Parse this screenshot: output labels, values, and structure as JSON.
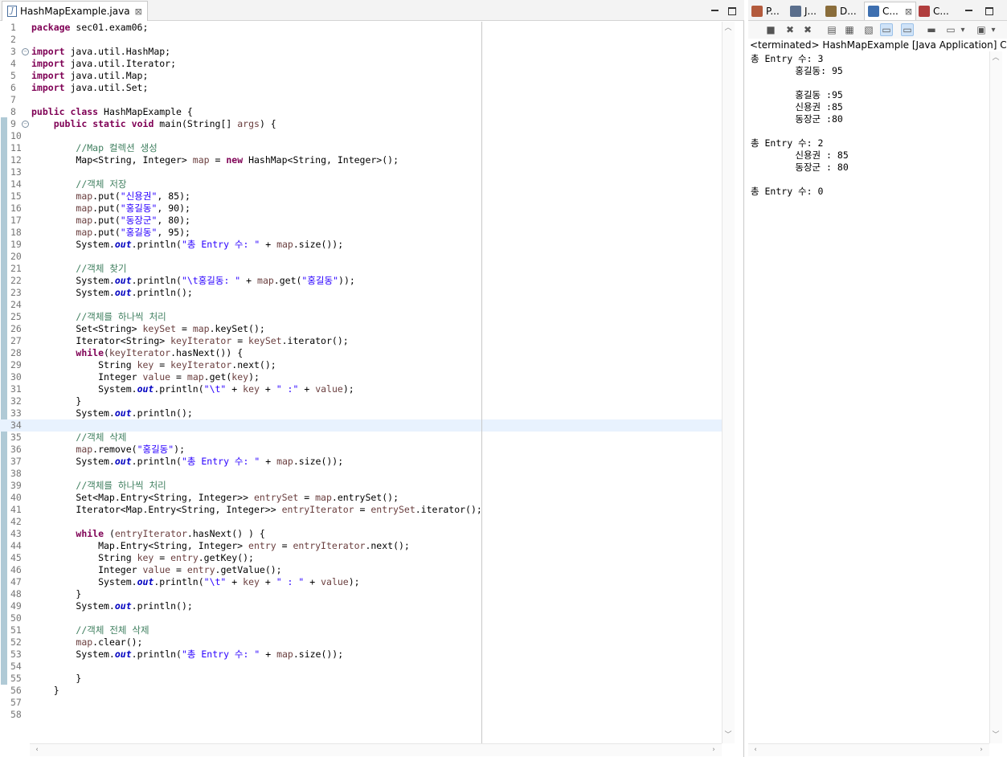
{
  "editor": {
    "tab": {
      "label": "HashMapExample.java",
      "close": "⊠",
      "icon": "java-file-icon"
    },
    "minimize_icon": "minimize-icon",
    "maximize_icon": "maximize-icon",
    "lines": [
      {
        "n": "1",
        "t": [
          {
            "k": "k",
            "x": "package"
          },
          {
            "k": "",
            "x": " sec01.exam06;"
          }
        ]
      },
      {
        "n": "2",
        "t": []
      },
      {
        "n": "3",
        "fold": true,
        "t": [
          {
            "k": "k",
            "x": "import"
          },
          {
            "k": "",
            "x": " java.util.HashMap;"
          }
        ]
      },
      {
        "n": "4",
        "t": [
          {
            "k": "k",
            "x": "import"
          },
          {
            "k": "",
            "x": " java.util.Iterator;"
          }
        ]
      },
      {
        "n": "5",
        "t": [
          {
            "k": "k",
            "x": "import"
          },
          {
            "k": "",
            "x": " java.util.Map;"
          }
        ]
      },
      {
        "n": "6",
        "t": [
          {
            "k": "k",
            "x": "import"
          },
          {
            "k": "",
            "x": " java.util.Set;"
          }
        ]
      },
      {
        "n": "7",
        "t": []
      },
      {
        "n": "8",
        "t": [
          {
            "k": "k",
            "x": "public"
          },
          {
            "k": "",
            "x": " "
          },
          {
            "k": "k",
            "x": "class"
          },
          {
            "k": "",
            "x": " HashMapExample {"
          }
        ]
      },
      {
        "n": "9",
        "fold": true,
        "t": [
          {
            "k": "",
            "x": "    "
          },
          {
            "k": "k",
            "x": "public"
          },
          {
            "k": "",
            "x": " "
          },
          {
            "k": "k",
            "x": "static"
          },
          {
            "k": "",
            "x": " "
          },
          {
            "k": "k",
            "x": "void"
          },
          {
            "k": "",
            "x": " main(String[] "
          },
          {
            "k": "v",
            "x": "args"
          },
          {
            "k": "",
            "x": ") {"
          }
        ]
      },
      {
        "n": "10",
        "t": []
      },
      {
        "n": "11",
        "t": [
          {
            "k": "",
            "x": "        "
          },
          {
            "k": "c",
            "x": "//Map 컬렉션 생성"
          }
        ]
      },
      {
        "n": "12",
        "t": [
          {
            "k": "",
            "x": "        Map<String, Integer> "
          },
          {
            "k": "v",
            "x": "map"
          },
          {
            "k": "",
            "x": " = "
          },
          {
            "k": "k",
            "x": "new"
          },
          {
            "k": "",
            "x": " HashMap<String, Integer>();"
          }
        ]
      },
      {
        "n": "13",
        "t": []
      },
      {
        "n": "14",
        "t": [
          {
            "k": "",
            "x": "        "
          },
          {
            "k": "c",
            "x": "//객체 저장"
          }
        ]
      },
      {
        "n": "15",
        "t": [
          {
            "k": "",
            "x": "        "
          },
          {
            "k": "v",
            "x": "map"
          },
          {
            "k": "",
            "x": ".put("
          },
          {
            "k": "s",
            "x": "\"신용권\""
          },
          {
            "k": "",
            "x": ", 85);"
          }
        ]
      },
      {
        "n": "16",
        "t": [
          {
            "k": "",
            "x": "        "
          },
          {
            "k": "v",
            "x": "map"
          },
          {
            "k": "",
            "x": ".put("
          },
          {
            "k": "s",
            "x": "\"홍길동\""
          },
          {
            "k": "",
            "x": ", 90);"
          }
        ]
      },
      {
        "n": "17",
        "t": [
          {
            "k": "",
            "x": "        "
          },
          {
            "k": "v",
            "x": "map"
          },
          {
            "k": "",
            "x": ".put("
          },
          {
            "k": "s",
            "x": "\"동장군\""
          },
          {
            "k": "",
            "x": ", 80);"
          }
        ]
      },
      {
        "n": "18",
        "t": [
          {
            "k": "",
            "x": "        "
          },
          {
            "k": "v",
            "x": "map"
          },
          {
            "k": "",
            "x": ".put("
          },
          {
            "k": "s",
            "x": "\"홍길동\""
          },
          {
            "k": "",
            "x": ", 95);"
          }
        ]
      },
      {
        "n": "19",
        "t": [
          {
            "k": "",
            "x": "        System."
          },
          {
            "k": "f",
            "x": "out"
          },
          {
            "k": "",
            "x": ".println("
          },
          {
            "k": "s",
            "x": "\"총 Entry 수: \""
          },
          {
            "k": "",
            "x": " + "
          },
          {
            "k": "v",
            "x": "map"
          },
          {
            "k": "",
            "x": ".size());"
          }
        ]
      },
      {
        "n": "20",
        "t": []
      },
      {
        "n": "21",
        "t": [
          {
            "k": "",
            "x": "        "
          },
          {
            "k": "c",
            "x": "//객체 찾기"
          }
        ]
      },
      {
        "n": "22",
        "t": [
          {
            "k": "",
            "x": "        System."
          },
          {
            "k": "f",
            "x": "out"
          },
          {
            "k": "",
            "x": ".println("
          },
          {
            "k": "s",
            "x": "\"\\t홍길동: \""
          },
          {
            "k": "",
            "x": " + "
          },
          {
            "k": "v",
            "x": "map"
          },
          {
            "k": "",
            "x": ".get("
          },
          {
            "k": "s",
            "x": "\"홍길동\""
          },
          {
            "k": "",
            "x": "));"
          }
        ]
      },
      {
        "n": "23",
        "t": [
          {
            "k": "",
            "x": "        System."
          },
          {
            "k": "f",
            "x": "out"
          },
          {
            "k": "",
            "x": ".println();"
          }
        ]
      },
      {
        "n": "24",
        "t": []
      },
      {
        "n": "25",
        "t": [
          {
            "k": "",
            "x": "        "
          },
          {
            "k": "c",
            "x": "//객체를 하나씩 처리"
          }
        ]
      },
      {
        "n": "26",
        "t": [
          {
            "k": "",
            "x": "        Set<String> "
          },
          {
            "k": "v",
            "x": "keySet"
          },
          {
            "k": "",
            "x": " = "
          },
          {
            "k": "v",
            "x": "map"
          },
          {
            "k": "",
            "x": ".keySet();"
          }
        ]
      },
      {
        "n": "27",
        "t": [
          {
            "k": "",
            "x": "        Iterator<String> "
          },
          {
            "k": "v",
            "x": "keyIterator"
          },
          {
            "k": "",
            "x": " = "
          },
          {
            "k": "v",
            "x": "keySet"
          },
          {
            "k": "",
            "x": ".iterator();"
          }
        ]
      },
      {
        "n": "28",
        "t": [
          {
            "k": "",
            "x": "        "
          },
          {
            "k": "k",
            "x": "while"
          },
          {
            "k": "",
            "x": "("
          },
          {
            "k": "v",
            "x": "keyIterator"
          },
          {
            "k": "",
            "x": ".hasNext()) {"
          }
        ]
      },
      {
        "n": "29",
        "t": [
          {
            "k": "",
            "x": "            String "
          },
          {
            "k": "v",
            "x": "key"
          },
          {
            "k": "",
            "x": " = "
          },
          {
            "k": "v",
            "x": "keyIterator"
          },
          {
            "k": "",
            "x": ".next();"
          }
        ]
      },
      {
        "n": "30",
        "t": [
          {
            "k": "",
            "x": "            Integer "
          },
          {
            "k": "v",
            "x": "value"
          },
          {
            "k": "",
            "x": " = "
          },
          {
            "k": "v",
            "x": "map"
          },
          {
            "k": "",
            "x": ".get("
          },
          {
            "k": "v",
            "x": "key"
          },
          {
            "k": "",
            "x": ");"
          }
        ]
      },
      {
        "n": "31",
        "t": [
          {
            "k": "",
            "x": "            System."
          },
          {
            "k": "f",
            "x": "out"
          },
          {
            "k": "",
            "x": ".println("
          },
          {
            "k": "s",
            "x": "\"\\t\""
          },
          {
            "k": "",
            "x": " + "
          },
          {
            "k": "v",
            "x": "key"
          },
          {
            "k": "",
            "x": " + "
          },
          {
            "k": "s",
            "x": "\" :\""
          },
          {
            "k": "",
            "x": " + "
          },
          {
            "k": "v",
            "x": "value"
          },
          {
            "k": "",
            "x": ");"
          }
        ]
      },
      {
        "n": "32",
        "t": [
          {
            "k": "",
            "x": "        }"
          }
        ]
      },
      {
        "n": "33",
        "t": [
          {
            "k": "",
            "x": "        System."
          },
          {
            "k": "f",
            "x": "out"
          },
          {
            "k": "",
            "x": ".println();"
          }
        ]
      },
      {
        "n": "34",
        "hl": true,
        "t": []
      },
      {
        "n": "35",
        "t": [
          {
            "k": "",
            "x": "        "
          },
          {
            "k": "c",
            "x": "//객체 삭제"
          }
        ]
      },
      {
        "n": "36",
        "t": [
          {
            "k": "",
            "x": "        "
          },
          {
            "k": "v",
            "x": "map"
          },
          {
            "k": "",
            "x": ".remove("
          },
          {
            "k": "s",
            "x": "\"홍길동\""
          },
          {
            "k": "",
            "x": ");"
          }
        ]
      },
      {
        "n": "37",
        "t": [
          {
            "k": "",
            "x": "        System."
          },
          {
            "k": "f",
            "x": "out"
          },
          {
            "k": "",
            "x": ".println("
          },
          {
            "k": "s",
            "x": "\"총 Entry 수: \""
          },
          {
            "k": "",
            "x": " + "
          },
          {
            "k": "v",
            "x": "map"
          },
          {
            "k": "",
            "x": ".size());"
          }
        ]
      },
      {
        "n": "38",
        "t": []
      },
      {
        "n": "39",
        "t": [
          {
            "k": "",
            "x": "        "
          },
          {
            "k": "c",
            "x": "//객체를 하나씩 처리"
          }
        ]
      },
      {
        "n": "40",
        "t": [
          {
            "k": "",
            "x": "        Set<Map.Entry<String, Integer>> "
          },
          {
            "k": "v",
            "x": "entrySet"
          },
          {
            "k": "",
            "x": " = "
          },
          {
            "k": "v",
            "x": "map"
          },
          {
            "k": "",
            "x": ".entrySet();"
          }
        ]
      },
      {
        "n": "41",
        "t": [
          {
            "k": "",
            "x": "        Iterator<Map.Entry<String, Integer>> "
          },
          {
            "k": "v",
            "x": "entryIterator"
          },
          {
            "k": "",
            "x": " = "
          },
          {
            "k": "v",
            "x": "entrySet"
          },
          {
            "k": "",
            "x": ".iterator();"
          }
        ]
      },
      {
        "n": "42",
        "t": []
      },
      {
        "n": "43",
        "t": [
          {
            "k": "",
            "x": "        "
          },
          {
            "k": "k",
            "x": "while"
          },
          {
            "k": "",
            "x": " ("
          },
          {
            "k": "v",
            "x": "entryIterator"
          },
          {
            "k": "",
            "x": ".hasNext() ) {"
          }
        ]
      },
      {
        "n": "44",
        "t": [
          {
            "k": "",
            "x": "            Map.Entry<String, Integer> "
          },
          {
            "k": "v",
            "x": "entry"
          },
          {
            "k": "",
            "x": " = "
          },
          {
            "k": "v",
            "x": "entryIterator"
          },
          {
            "k": "",
            "x": ".next();"
          }
        ]
      },
      {
        "n": "45",
        "t": [
          {
            "k": "",
            "x": "            String "
          },
          {
            "k": "v",
            "x": "key"
          },
          {
            "k": "",
            "x": " = "
          },
          {
            "k": "v",
            "x": "entry"
          },
          {
            "k": "",
            "x": ".getKey();"
          }
        ]
      },
      {
        "n": "46",
        "t": [
          {
            "k": "",
            "x": "            Integer "
          },
          {
            "k": "v",
            "x": "value"
          },
          {
            "k": "",
            "x": " = "
          },
          {
            "k": "v",
            "x": "entry"
          },
          {
            "k": "",
            "x": ".getValue();"
          }
        ]
      },
      {
        "n": "47",
        "t": [
          {
            "k": "",
            "x": "            System."
          },
          {
            "k": "f",
            "x": "out"
          },
          {
            "k": "",
            "x": ".println("
          },
          {
            "k": "s",
            "x": "\"\\t\""
          },
          {
            "k": "",
            "x": " + "
          },
          {
            "k": "v",
            "x": "key"
          },
          {
            "k": "",
            "x": " + "
          },
          {
            "k": "s",
            "x": "\" : \""
          },
          {
            "k": "",
            "x": " + "
          },
          {
            "k": "v",
            "x": "value"
          },
          {
            "k": "",
            "x": ");"
          }
        ]
      },
      {
        "n": "48",
        "t": [
          {
            "k": "",
            "x": "        }"
          }
        ]
      },
      {
        "n": "49",
        "t": [
          {
            "k": "",
            "x": "        System."
          },
          {
            "k": "f",
            "x": "out"
          },
          {
            "k": "",
            "x": ".println();"
          }
        ]
      },
      {
        "n": "50",
        "t": []
      },
      {
        "n": "51",
        "t": [
          {
            "k": "",
            "x": "        "
          },
          {
            "k": "c",
            "x": "//객체 전체 삭제"
          }
        ]
      },
      {
        "n": "52",
        "t": [
          {
            "k": "",
            "x": "        "
          },
          {
            "k": "v",
            "x": "map"
          },
          {
            "k": "",
            "x": ".clear();"
          }
        ]
      },
      {
        "n": "53",
        "t": [
          {
            "k": "",
            "x": "        System."
          },
          {
            "k": "f",
            "x": "out"
          },
          {
            "k": "",
            "x": ".println("
          },
          {
            "k": "s",
            "x": "\"총 Entry 수: \""
          },
          {
            "k": "",
            "x": " + "
          },
          {
            "k": "v",
            "x": "map"
          },
          {
            "k": "",
            "x": ".size());"
          }
        ]
      },
      {
        "n": "54",
        "t": []
      },
      {
        "n": "55",
        "t": [
          {
            "k": "",
            "x": "        }"
          }
        ]
      },
      {
        "n": "56",
        "t": [
          {
            "k": "",
            "x": "    }"
          }
        ]
      },
      {
        "n": "57",
        "t": []
      },
      {
        "n": "58",
        "t": []
      }
    ]
  },
  "right_panel": {
    "tabs": [
      {
        "label": "P...",
        "icon": "package-explorer-icon",
        "color": "#b35a3c"
      },
      {
        "label": "J...",
        "icon": "javadoc-icon",
        "color": "#5a6e8c"
      },
      {
        "label": "D...",
        "icon": "declaration-icon",
        "color": "#8a6d3b"
      },
      {
        "label": "C...",
        "icon": "console-icon",
        "color": "#3d6fb0",
        "active": true
      },
      {
        "label": "C...",
        "icon": "coverage-icon",
        "color": "#b03d3d"
      }
    ],
    "active_close": "⊠",
    "toolbar": [
      {
        "name": "terminate-icon",
        "glyph": "■"
      },
      {
        "name": "remove-launch-icon",
        "glyph": "✖"
      },
      {
        "name": "remove-all-terminated-icon",
        "glyph": "✖"
      },
      {
        "name": "clear-console-icon",
        "glyph": "▤"
      },
      {
        "name": "scroll-lock-icon",
        "glyph": "▦"
      },
      {
        "name": "word-wrap-icon",
        "glyph": "▧"
      },
      {
        "name": "show-on-stdout-icon",
        "glyph": "▭",
        "on": true
      },
      {
        "name": "show-on-stderr-icon",
        "glyph": "▭",
        "on": true
      },
      {
        "name": "pin-console-icon",
        "glyph": "▬"
      },
      {
        "name": "display-console-icon",
        "glyph": "▭"
      },
      {
        "name": "display-console-dropdown-icon",
        "glyph": "▾"
      },
      {
        "name": "open-console-icon",
        "glyph": "▣"
      },
      {
        "name": "open-console-dropdown-icon",
        "glyph": "▾"
      }
    ],
    "status": "<terminated> HashMapExample [Java Application] C:\\Pro",
    "output": [
      "총 Entry 수: 3",
      "\t홍길동: 95",
      "",
      "\t홍길동 :95",
      "\t신용권 :85",
      "\t동장군 :80",
      "",
      "총 Entry 수: 2",
      "\t신용권 : 85",
      "\t동장군 : 80",
      "",
      "총 Entry 수: 0"
    ]
  }
}
